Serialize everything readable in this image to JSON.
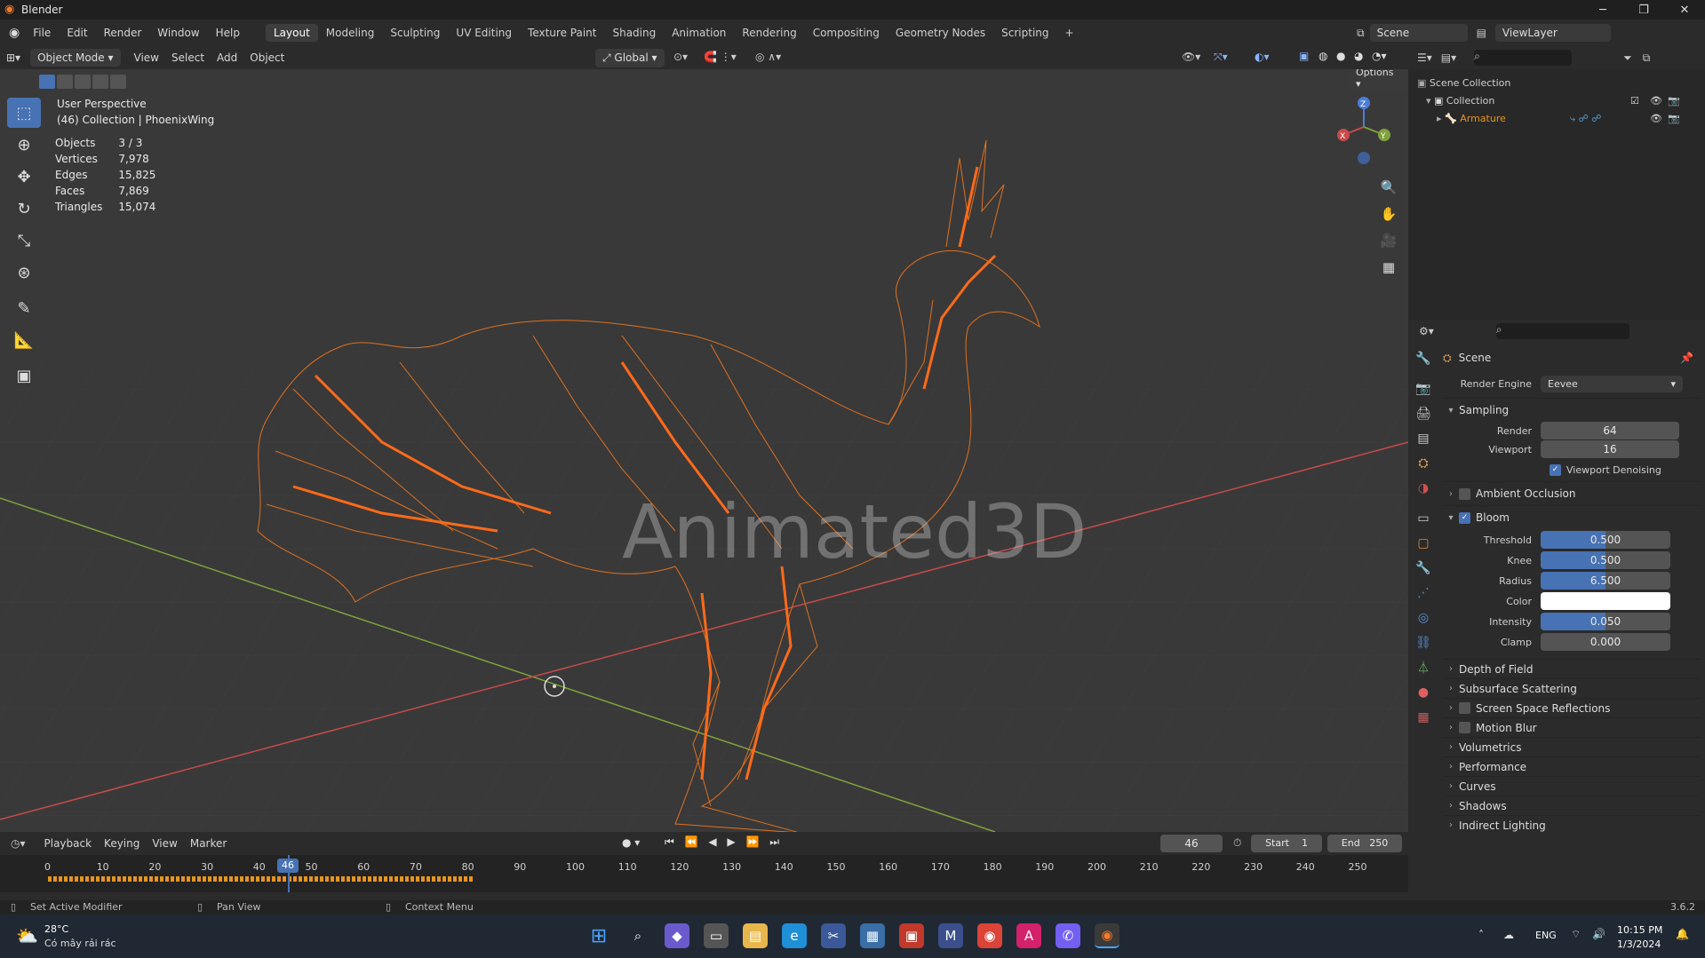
{
  "app": {
    "title": "Blender",
    "version": "3.6.2"
  },
  "menu": [
    "File",
    "Edit",
    "Render",
    "Window",
    "Help"
  ],
  "workspaces": [
    "Layout",
    "Modeling",
    "Sculpting",
    "UV Editing",
    "Texture Paint",
    "Shading",
    "Animation",
    "Rendering",
    "Compositing",
    "Geometry Nodes",
    "Scripting",
    "+"
  ],
  "active_workspace": "Layout",
  "scene_selector": "Scene",
  "view_layer": "ViewLayer",
  "viewport_header": {
    "mode": "Object Mode",
    "menus": [
      "View",
      "Select",
      "Add",
      "Object"
    ],
    "transform_orientation": "Global",
    "options": "Options"
  },
  "viewport_overlay": {
    "perspective": "User Perspective",
    "collection_line": "(46) Collection | PhoenixWing",
    "stats": [
      {
        "label": "Objects",
        "value": "3 / 3"
      },
      {
        "label": "Vertices",
        "value": "7,978"
      },
      {
        "label": "Edges",
        "value": "15,825"
      },
      {
        "label": "Faces",
        "value": "7,869"
      },
      {
        "label": "Triangles",
        "value": "15,074"
      }
    ],
    "watermark": "Animated3D"
  },
  "gizmo": {
    "x": "X",
    "y": "Y",
    "z": "Z"
  },
  "outliner": {
    "root": "Scene Collection",
    "collection": "Collection",
    "item": "Armature"
  },
  "properties": {
    "header": "Scene",
    "render_engine_label": "Render Engine",
    "render_engine": "Eevee",
    "sampling": {
      "title": "Sampling",
      "render_label": "Render",
      "render_value": "64",
      "viewport_label": "Viewport",
      "viewport_value": "16",
      "denoise_label": "Viewport Denoising",
      "denoise_checked": true
    },
    "ambient_occlusion": "Ambient Occlusion",
    "bloom": {
      "title": "Bloom",
      "enabled": true,
      "threshold_label": "Threshold",
      "threshold": "0.500",
      "knee_label": "Knee",
      "knee": "0.500",
      "radius_label": "Radius",
      "radius": "6.500",
      "color_label": "Color",
      "intensity_label": "Intensity",
      "intensity": "0.050",
      "clamp_label": "Clamp",
      "clamp": "0.000"
    },
    "collapsed_sections": [
      "Depth of Field",
      "Subsurface Scattering",
      "Screen Space Reflections",
      "Motion Blur",
      "Volumetrics",
      "Performance",
      "Curves",
      "Shadows",
      "Indirect Lighting"
    ]
  },
  "timeline": {
    "menus": [
      "Playback",
      "Keying",
      "View",
      "Marker"
    ],
    "current_frame": "46",
    "start_label": "Start",
    "start": "1",
    "end_label": "End",
    "end": "250",
    "ticks": [
      "0",
      "10",
      "20",
      "30",
      "40",
      "50",
      "60",
      "70",
      "80",
      "90",
      "100",
      "110",
      "120",
      "130",
      "140",
      "150",
      "160",
      "170",
      "180",
      "190",
      "200",
      "210",
      "220",
      "230",
      "240",
      "250"
    ]
  },
  "statusbar": {
    "left": "Set Active Modifier",
    "middle": "Pan View",
    "right": "Context Menu"
  },
  "taskbar": {
    "weather_temp": "28°C",
    "weather_desc": "Có mây rải rác",
    "lang": "ENG",
    "time": "10:15 PM",
    "date": "1/3/2024"
  },
  "colors": {
    "accent": "#4772b3",
    "wire": "#f07a2a",
    "bone": "#ff6a1a",
    "x_axis": "#c94a4a",
    "y_axis": "#7fa23c"
  }
}
